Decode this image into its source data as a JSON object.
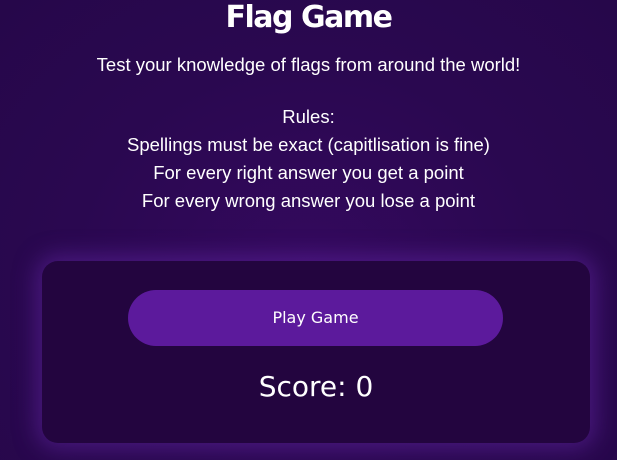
{
  "header": {
    "title": "Flag Game",
    "subtitle": "Test your knowledge of flags from around the world!"
  },
  "rules": {
    "heading": "Rules:",
    "items": [
      "Spellings must be exact (capitlisation is fine)",
      "For every right answer you get a point",
      "For every wrong answer you lose a point"
    ]
  },
  "game": {
    "play_label": "Play Game",
    "score_text": "Score: 0"
  },
  "colors": {
    "background": "#2a0850",
    "card": "#23053f",
    "button": "#5c1a9c",
    "text": "#ffffff"
  }
}
